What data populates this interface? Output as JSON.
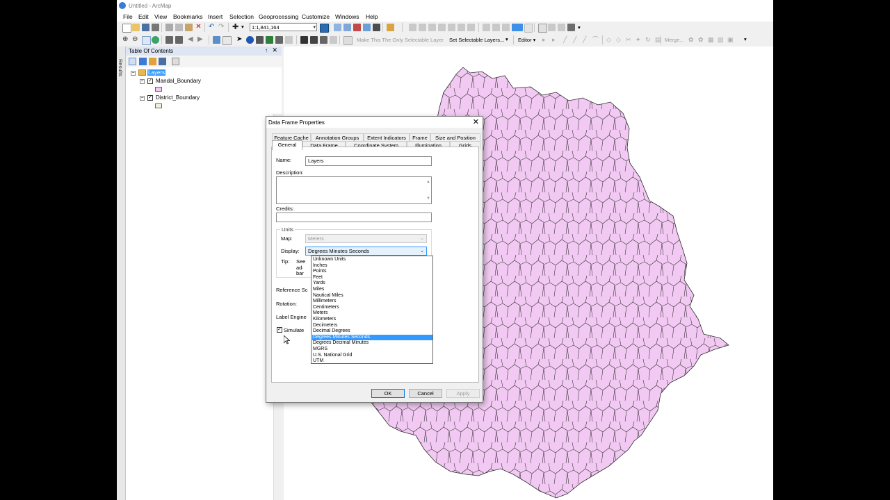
{
  "window": {
    "title": "Untitled - ArcMap"
  },
  "menu": [
    "File",
    "Edit",
    "View",
    "Bookmarks",
    "Insert",
    "Selection",
    "Geoprocessing",
    "Customize",
    "Windows",
    "Help"
  ],
  "toolbar": {
    "scale": "1:1,841,164",
    "make_selectable_label": "Make This The Only Selectable Layer",
    "set_selectable_label": "Set Selectable Layers...",
    "editor_label": "Editor ▾",
    "merge_label": "Merge..."
  },
  "toc": {
    "title": "Table Of Contents",
    "pin": "↑",
    "close": "✕",
    "results_label": "Results",
    "root": "Layers",
    "layers": [
      {
        "name": "Mandal_Boundary",
        "checked": "✓",
        "swatch_color": "#f2c9f2"
      },
      {
        "name": "District_Boundary",
        "checked": "✓",
        "swatch_color": "#eaf6d9"
      }
    ]
  },
  "dialog": {
    "title": "Data Frame Properties",
    "close": "✕",
    "tabs_back": [
      "Feature Cache",
      "Annotation Groups",
      "Extent Indicators",
      "Frame",
      "Size and Position"
    ],
    "tabs_front": [
      "General",
      "Data Frame",
      "Coordinate System",
      "Illumination",
      "Grids"
    ],
    "labels": {
      "name": "Name:",
      "description": "Description:",
      "credits": "Credits:",
      "units": "Units",
      "map": "Map:",
      "display": "Display:",
      "tip": "Tip:",
      "tip_text_1": "See",
      "tip_text_2": "ad·",
      "tip_text_3": "bar",
      "reference_scale": "Reference Sc",
      "rotation": "Rotation:",
      "label_engine": "Label Engine",
      "simulate": "Simulate "
    },
    "values": {
      "name": "Layers",
      "map_units": "Meters",
      "display_units": "Degrees Minutes Seconds",
      "simulate_checked": "✓"
    },
    "display_options": [
      "Unknown Units",
      "Inches",
      "Points",
      "Feet",
      "Yards",
      "Miles",
      "Nautical Miles",
      "Millimeters",
      "Centimeters",
      "Meters",
      "Kilometers",
      "Decimeters",
      "Decimal Degrees",
      "Degrees Minutes Seconds",
      "Degrees Decimal Minutes",
      "MGRS",
      "U.S. National Grid",
      "UTM"
    ],
    "buttons": {
      "ok": "OK",
      "cancel": "Cancel",
      "apply": "Apply"
    }
  },
  "map": {
    "fill_color": "#f2c9f2",
    "outline_color": "#2a2a2a"
  }
}
